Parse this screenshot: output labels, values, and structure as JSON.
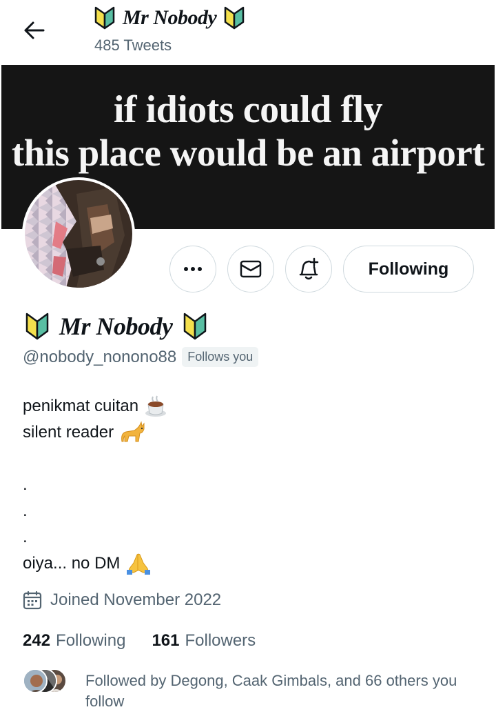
{
  "header": {
    "display_name": "Mr Nobody",
    "tweets_count": "485 Tweets"
  },
  "banner": {
    "line1": "if idiots could fly",
    "line2": "this place would be an airport"
  },
  "actions": {
    "following_label": "Following"
  },
  "profile": {
    "display_name": "Mr Nobody",
    "handle": "@nobody_nonono88",
    "follows_you": "Follows you",
    "bio": {
      "line1": "penikmat cuitan",
      "line2": "silent reader",
      "dot1": ".",
      "dot2": ".",
      "dot3": ".",
      "line3": "oiya... no DM"
    },
    "joined": "Joined November 2022"
  },
  "stats": {
    "following_count": "242",
    "following_label": "Following",
    "followers_count": "161",
    "followers_label": "Followers"
  },
  "followed_by": {
    "text": "Followed by Degong, Caak Gimbals, and 66 others you follow"
  },
  "icons": {
    "back": "arrow-left-icon",
    "badge": "beginner-mark-icon",
    "more": "more-icon",
    "message": "envelope-icon",
    "notify": "bell-plus-icon",
    "calendar": "calendar-icon",
    "coffee": "coffee-icon",
    "cat": "cat-icon",
    "pray": "folded-hands-icon"
  },
  "colors": {
    "text": "#0f1419",
    "secondary": "#536471",
    "border": "#cfd9de",
    "banner_bg": "#151515"
  }
}
